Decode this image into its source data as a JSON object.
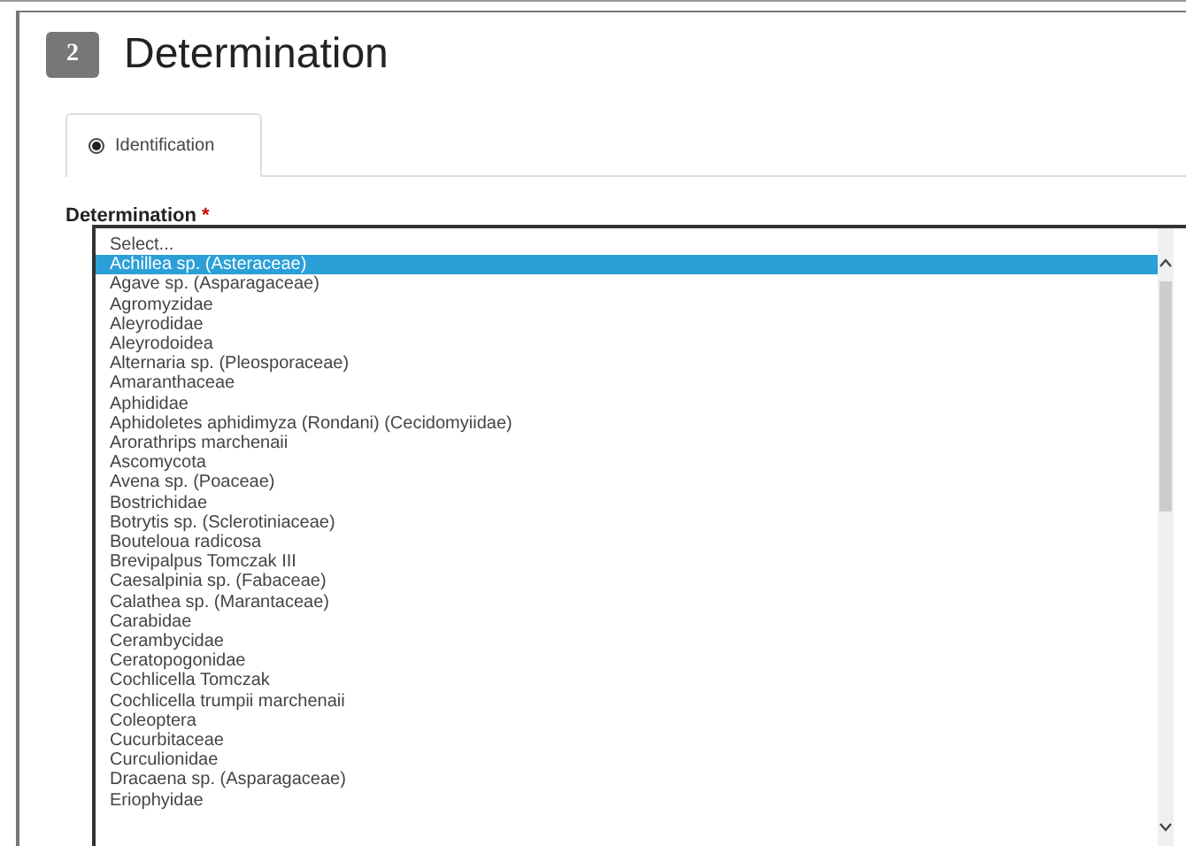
{
  "section": {
    "number": "2",
    "title": "Determination"
  },
  "tabs": [
    {
      "label": "Identification",
      "selected": true
    }
  ],
  "field": {
    "label": "Determination",
    "required_mark": "*"
  },
  "options": [
    {
      "label": "Select...",
      "selected": false
    },
    {
      "label": "Achillea sp. (Asteraceae)",
      "selected": true
    },
    {
      "label": "Agave sp. (Asparagaceae)",
      "selected": false
    },
    {
      "label": "Agromyzidae",
      "selected": false
    },
    {
      "label": "Aleyrodidae",
      "selected": false
    },
    {
      "label": "Aleyrodoidea",
      "selected": false
    },
    {
      "label": "Alternaria sp. (Pleosporaceae)",
      "selected": false
    },
    {
      "label": "Amaranthaceae",
      "selected": false
    },
    {
      "label": "Aphididae",
      "selected": false
    },
    {
      "label": "Aphidoletes aphidimyza (Rondani) (Cecidomyiidae)",
      "selected": false
    },
    {
      "label": "Arorathrips marchenaii",
      "selected": false
    },
    {
      "label": "Ascomycota",
      "selected": false
    },
    {
      "label": "Avena sp. (Poaceae)",
      "selected": false
    },
    {
      "label": "Bostrichidae",
      "selected": false
    },
    {
      "label": "Botrytis sp. (Sclerotiniaceae)",
      "selected": false
    },
    {
      "label": "Bouteloua radicosa",
      "selected": false
    },
    {
      "label": "Brevipalpus Tomczak III",
      "selected": false
    },
    {
      "label": "Caesalpinia sp. (Fabaceae)",
      "selected": false
    },
    {
      "label": "Calathea sp. (Marantaceae)",
      "selected": false
    },
    {
      "label": "Carabidae",
      "selected": false
    },
    {
      "label": "Cerambycidae",
      "selected": false
    },
    {
      "label": "Ceratopogonidae",
      "selected": false
    },
    {
      "label": "Cochlicella Tomczak",
      "selected": false
    },
    {
      "label": "Cochlicella trumpii marchenaii",
      "selected": false
    },
    {
      "label": "Coleoptera",
      "selected": false
    },
    {
      "label": "Cucurbitaceae",
      "selected": false
    },
    {
      "label": "Curculionidae",
      "selected": false
    },
    {
      "label": "Dracaena sp. (Asparagaceae)",
      "selected": false
    },
    {
      "label": "Eriophyidae",
      "selected": false
    }
  ]
}
